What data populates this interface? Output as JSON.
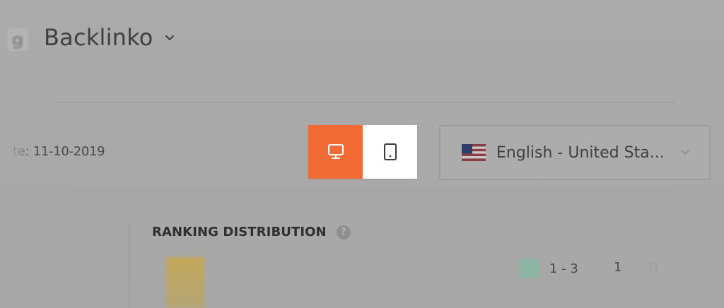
{
  "header": {
    "logo_letter": "g",
    "project_name": "Backlinko"
  },
  "toolbar": {
    "date_text": "te: 11-10-2019",
    "device_toggle": {
      "desktop_label": "desktop-icon",
      "mobile_label": "tablet-icon",
      "active": "desktop"
    },
    "language": {
      "selected": "English - United Sta...",
      "flag": "us-flag-icon"
    }
  },
  "ranking_distribution": {
    "title": "RANKING DISTRIBUTION",
    "help_symbol": "?",
    "legend": [
      {
        "range": "1 - 3",
        "count": "1",
        "color": "#8fb6a4"
      }
    ],
    "extra_symbol": "()"
  },
  "colors": {
    "accent": "#f26b35",
    "overlay": "#a9a9a9",
    "white": "#ffffff"
  }
}
